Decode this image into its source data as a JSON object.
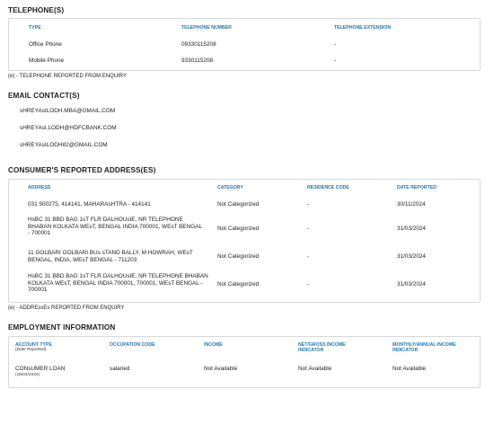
{
  "telephones": {
    "title": "TELEPHONE(S)",
    "headers": [
      "TYPE",
      "TELEPHONE NUMBER",
      "TELEPHONE EXTENSION"
    ],
    "rows": [
      [
        "Office Phone",
        "09330115208",
        "-"
      ],
      [
        "Mobile Phone",
        "9330115208",
        "-"
      ]
    ],
    "note": "(e) - TELEPHONE REPORTED FROM ENQUIRY"
  },
  "emails": {
    "title": "EMAIL CONTACT(S)",
    "items": [
      "sHREYAsILODH.MBA@GMAIL.COM",
      "sHREYAsI.LODH@HDFCBANK.COM",
      "sHREYAsILODH82@GMAIL.COM"
    ]
  },
  "addresses": {
    "title": "CONSUMER'S REPORTED ADDRESS(ES)",
    "headers": [
      "ADDRESS",
      "CATEGORY",
      "RESIDENCE CODE",
      "DATE REPORTED"
    ],
    "rows": [
      [
        "031 500275, 414141, MAHARAsHTRA - 414141",
        "Not Categorized",
        "-",
        "30/11/2024"
      ],
      [
        "HsBC 31 BBD BAG 1sT FLR DALHOUsIE, NR TELEPHONE BHABAN KOLKATA WEsT, BENGAL INDIA 700001, WEsT BENGAL - 700001",
        "Not Categorized",
        "-",
        "31/03/2024"
      ],
      [
        "11 GOLBARI GOLBARI BUs sTAND BALLY, M HOWRAH, WEsT BENGAL, INDIA, WEsT BENGAL - 711203",
        "Not Categorized",
        "-",
        "31/03/2024"
      ],
      [
        "HsBC 31 BBD BAG 1sT FLR DALHOUsIE, NR TELEPHONE BHABAN KOLKATA WEsT, BENGAL INDIA 700001, 700001, WEsT BENGAL - 700001",
        "Not Categorized",
        "-",
        "31/03/2024"
      ]
    ],
    "note": "(e) - ADDREssEs REPORTED FROM ENQUIRY"
  },
  "employment": {
    "title": "EMPLOYMENT INFORMATION",
    "headers": [
      "ACCOUNT TYPE",
      "OCCUPATION CODE",
      "INCOME",
      "NET/GROSS INCOME INDICATOR",
      "MONTHLY/ANNUAL INCOME INDICATOR"
    ],
    "header_sub": "(Date Reported)",
    "row": {
      "account_type": "CONsUMER LOAN",
      "date_reported": "(16/04/2024)",
      "occupation": "salaried",
      "income": "Not Available",
      "net_gross": "Not Available",
      "monthly_annual": "Not Available"
    }
  }
}
